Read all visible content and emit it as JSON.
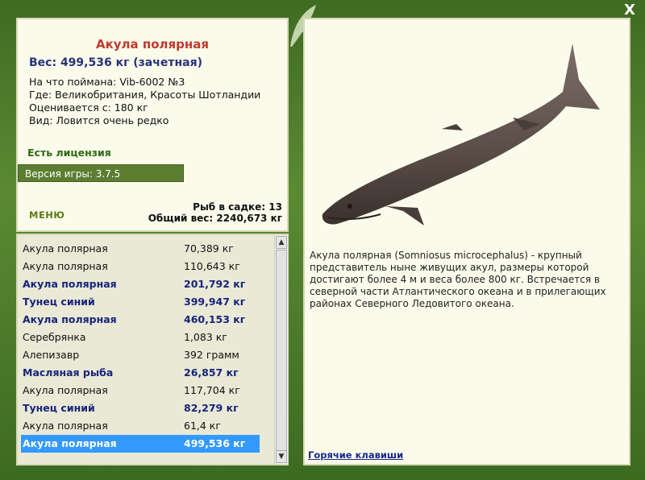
{
  "window": {
    "close_label": "X"
  },
  "fish": {
    "title": "Акула полярная",
    "weight": "Вес: 499,536 кг (зачетная)",
    "caught_with": "На что поймана: Vib-6002 №3",
    "location": "Где: Великобритания, Красоты Шотландии",
    "valued_from": "Оценивается с: 180 кг",
    "view": "Вид: Ловится очень редко"
  },
  "license": "Есть лицензия",
  "version": "Версия игры: 3.7.5",
  "menu_label": "МЕНЮ",
  "stats": {
    "fish_count": "Рыб в садке: 13",
    "total_weight": "Общий вес: 2240,673 кг"
  },
  "catch_list": [
    {
      "name": "Акула полярная",
      "weight": "70,389 кг",
      "bold": false
    },
    {
      "name": "Акула полярная",
      "weight": "110,643 кг",
      "bold": false
    },
    {
      "name": "Акула полярная",
      "weight": "201,792 кг",
      "bold": true
    },
    {
      "name": "Тунец синий",
      "weight": "399,947 кг",
      "bold": true
    },
    {
      "name": "Акула полярная",
      "weight": "460,153 кг",
      "bold": true
    },
    {
      "name": "Серебрянка",
      "weight": "1,083 кг",
      "bold": false
    },
    {
      "name": "Алепизавр",
      "weight": "392 грамм",
      "bold": false
    },
    {
      "name": "Масляная рыба",
      "weight": "26,857 кг",
      "bold": true
    },
    {
      "name": "Акула полярная",
      "weight": "117,704 кг",
      "bold": false
    },
    {
      "name": "Тунец синий",
      "weight": "82,279 кг",
      "bold": true
    },
    {
      "name": "Акула полярная",
      "weight": "61,4 кг",
      "bold": false
    },
    {
      "name": "Акула полярная",
      "weight": "499,536 кг",
      "bold": true,
      "selected": true
    }
  ],
  "description": "Акула полярная (Somniosus microcephalus) - крупный представитель ныне живущих акул, размеры которой достигают более 4 м и веса более 800 кг. Встречается в северной части Атлантического океана и в прилегающих районах Северного Ледовитого океана.",
  "hotkeys_label": "Горячие клавиши",
  "colors": {
    "title": "#c0392b",
    "weight": "#27337a",
    "selected_row": "#3399ff",
    "panel": "#fbfbec"
  }
}
